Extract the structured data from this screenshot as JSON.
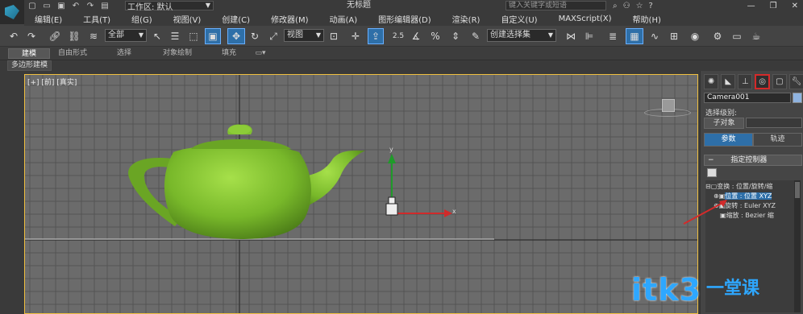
{
  "titlebar": {
    "workspace": "工作区: 默认",
    "title": "无标题",
    "search_placeholder": "键入关键字或短语",
    "quick_access": [
      "new",
      "open",
      "save",
      "undo",
      "redo",
      "project"
    ]
  },
  "menu": [
    "编辑(E)",
    "工具(T)",
    "组(G)",
    "视图(V)",
    "创建(C)",
    "修改器(M)",
    "动画(A)",
    "图形编辑器(D)",
    "渲染(R)",
    "自定义(U)",
    "MAXScript(X)",
    "帮助(H)"
  ],
  "toolbar": {
    "selection_filter": "全部",
    "ref_coord": "视图",
    "snap_angle": "2.5",
    "named_selection": "创建选择集"
  },
  "ribbon": {
    "tabs": [
      "建模",
      "自由形式",
      "选择",
      "对象绘制",
      "填充"
    ],
    "active_tab": "建模",
    "subtab": "多边形建模"
  },
  "viewport": {
    "label": "[+] [前] [真实]",
    "axis_x_label": "x",
    "axis_y_label": "y",
    "teapot_color": "#78b82a",
    "grid_color": "#555555",
    "background": "#6b6b6b"
  },
  "command_panel": {
    "tabs": [
      "create-icon",
      "modify-icon",
      "hierarchy-icon",
      "motion-icon",
      "display-icon",
      "utilities-icon"
    ],
    "active_tab": "motion-icon",
    "object_name": "Camera001",
    "selection_level_label": "选择级别:",
    "subobject_button": "子对象",
    "param_tab": "参数",
    "track_tab": "轨迹",
    "rollout_title": "指定控制器",
    "tree": [
      {
        "label": "变换 : 位置/旋转/缩",
        "selected": false
      },
      {
        "label": "位置 : 位置 XYZ",
        "selected": true
      },
      {
        "label": "旋转 : Euler XYZ",
        "selected": false
      },
      {
        "label": "缩放 : Bezier 缩",
        "selected": false
      }
    ]
  },
  "watermark": {
    "text": "itk3",
    "sub": "一堂课"
  }
}
